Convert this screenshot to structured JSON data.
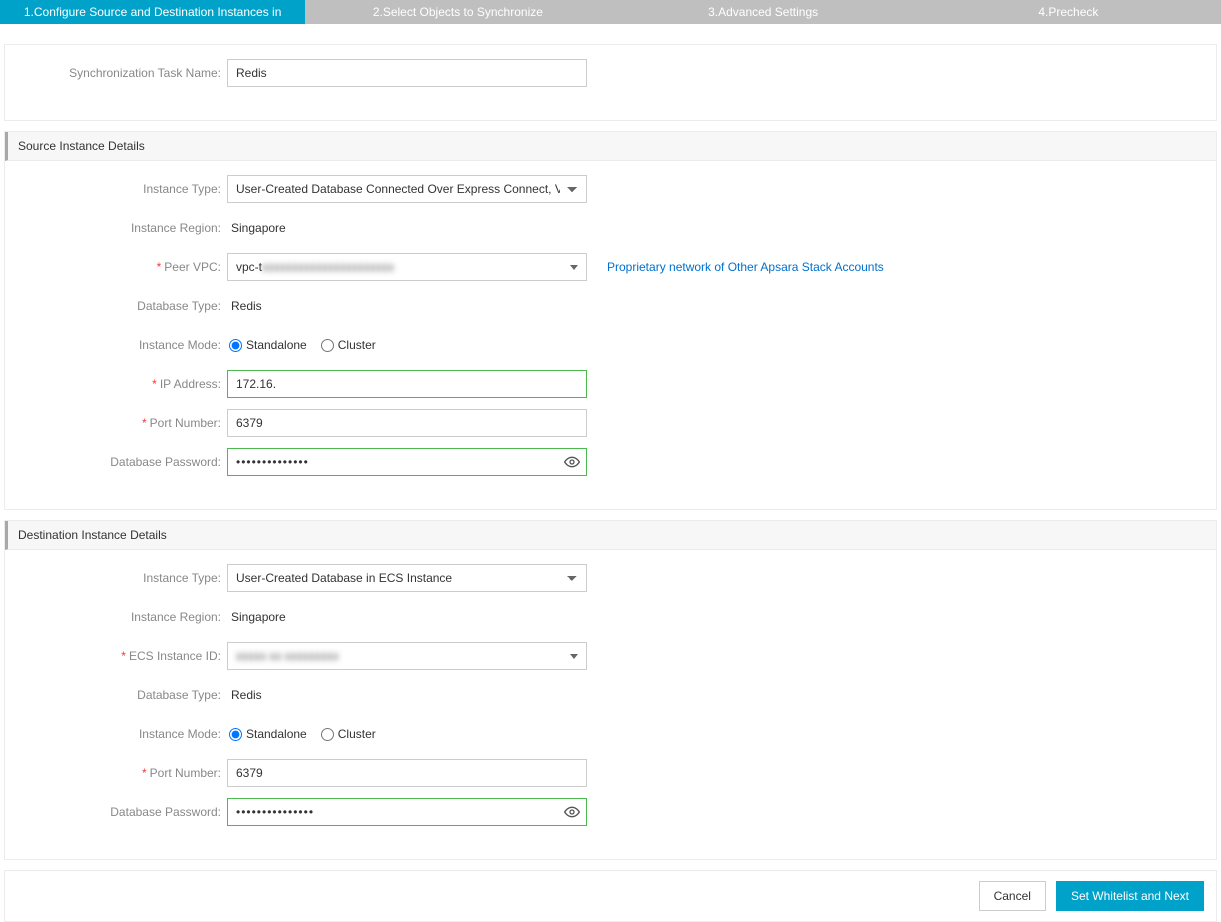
{
  "steps": {
    "s1": "1.Configure Source and Destination Instances in",
    "s2": "2.Select Objects to Synchronize",
    "s3": "3.Advanced Settings",
    "s4": "4.Precheck"
  },
  "task": {
    "name_label": "Synchronization Task Name:",
    "name_value": "Redis"
  },
  "source": {
    "section_title": "Source Instance Details",
    "instance_type_label": "Instance Type:",
    "instance_type_value": "User-Created Database Connected Over Express Connect, VPN",
    "instance_region_label": "Instance Region:",
    "instance_region_value": "Singapore",
    "peer_vpc_label": "Peer VPC:",
    "peer_vpc_value": "vpc-t",
    "peer_vpc_obscured": "xxxxxxxxxxxxxxxxxxxxxx",
    "vpc_link": "Proprietary network of Other Apsara Stack Accounts",
    "database_type_label": "Database Type:",
    "database_type_value": "Redis",
    "instance_mode_label": "Instance Mode:",
    "mode_standalone": "Standalone",
    "mode_cluster": "Cluster",
    "ip_label": "IP Address:",
    "ip_value": "172.16.",
    "port_label": "Port Number:",
    "port_value": "6379",
    "password_label": "Database Password:",
    "password_value": "••••••••••••••"
  },
  "dest": {
    "section_title": "Destination Instance Details",
    "instance_type_label": "Instance Type:",
    "instance_type_value": "User-Created Database in ECS Instance",
    "instance_region_label": "Instance Region:",
    "instance_region_value": "Singapore",
    "ecs_instance_label": "ECS Instance ID:",
    "ecs_instance_obscured": "xxxxx xx xxxxxxxxx",
    "database_type_label": "Database Type:",
    "database_type_value": "Redis",
    "instance_mode_label": "Instance Mode:",
    "mode_standalone": "Standalone",
    "mode_cluster": "Cluster",
    "port_label": "Port Number:",
    "port_value": "6379",
    "password_label": "Database Password:",
    "password_value": "•••••••••••••••"
  },
  "footer": {
    "cancel": "Cancel",
    "next": "Set Whitelist and Next"
  }
}
